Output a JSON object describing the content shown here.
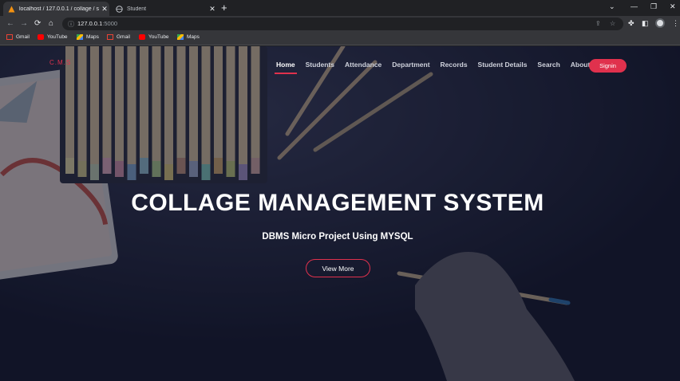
{
  "browser": {
    "tabs": [
      {
        "title": "localhost / 127.0.0.1 / collage / s",
        "close": "✕"
      },
      {
        "title": "Student",
        "close": "✕"
      }
    ],
    "new_tab": "+",
    "window_controls": {
      "minimize": "—",
      "restore": "❐",
      "close": "✕",
      "tab_search": "⌄"
    },
    "nav": {
      "back": "←",
      "forward": "→",
      "reload": "⟳",
      "home": "⌂"
    },
    "url": {
      "host": "127.0.0.1",
      "port": ":5000"
    },
    "bookmarks": [
      {
        "label": "Gmail",
        "icon": "gmail-icon"
      },
      {
        "label": "YouTube",
        "icon": "youtube-icon"
      },
      {
        "label": "Maps",
        "icon": "maps-icon"
      },
      {
        "label": "Gmail",
        "icon": "gmail-icon"
      },
      {
        "label": "YouTube",
        "icon": "youtube-icon"
      },
      {
        "label": "Maps",
        "icon": "maps-icon"
      }
    ]
  },
  "site": {
    "logo": "C.M.S",
    "nav": [
      "Home",
      "Students",
      "Attendance",
      "Department",
      "Records",
      "Student Details",
      "Search",
      "About"
    ],
    "active_nav": "Home",
    "signin": "Signin",
    "hero_title": "COLLAGE MANAGEMENT SYSTEM",
    "hero_subtitle": "DBMS Micro Project Using MYSQL",
    "cta": "View More"
  },
  "colors": {
    "accent": "#e0314d",
    "background": "#1b1e33"
  }
}
